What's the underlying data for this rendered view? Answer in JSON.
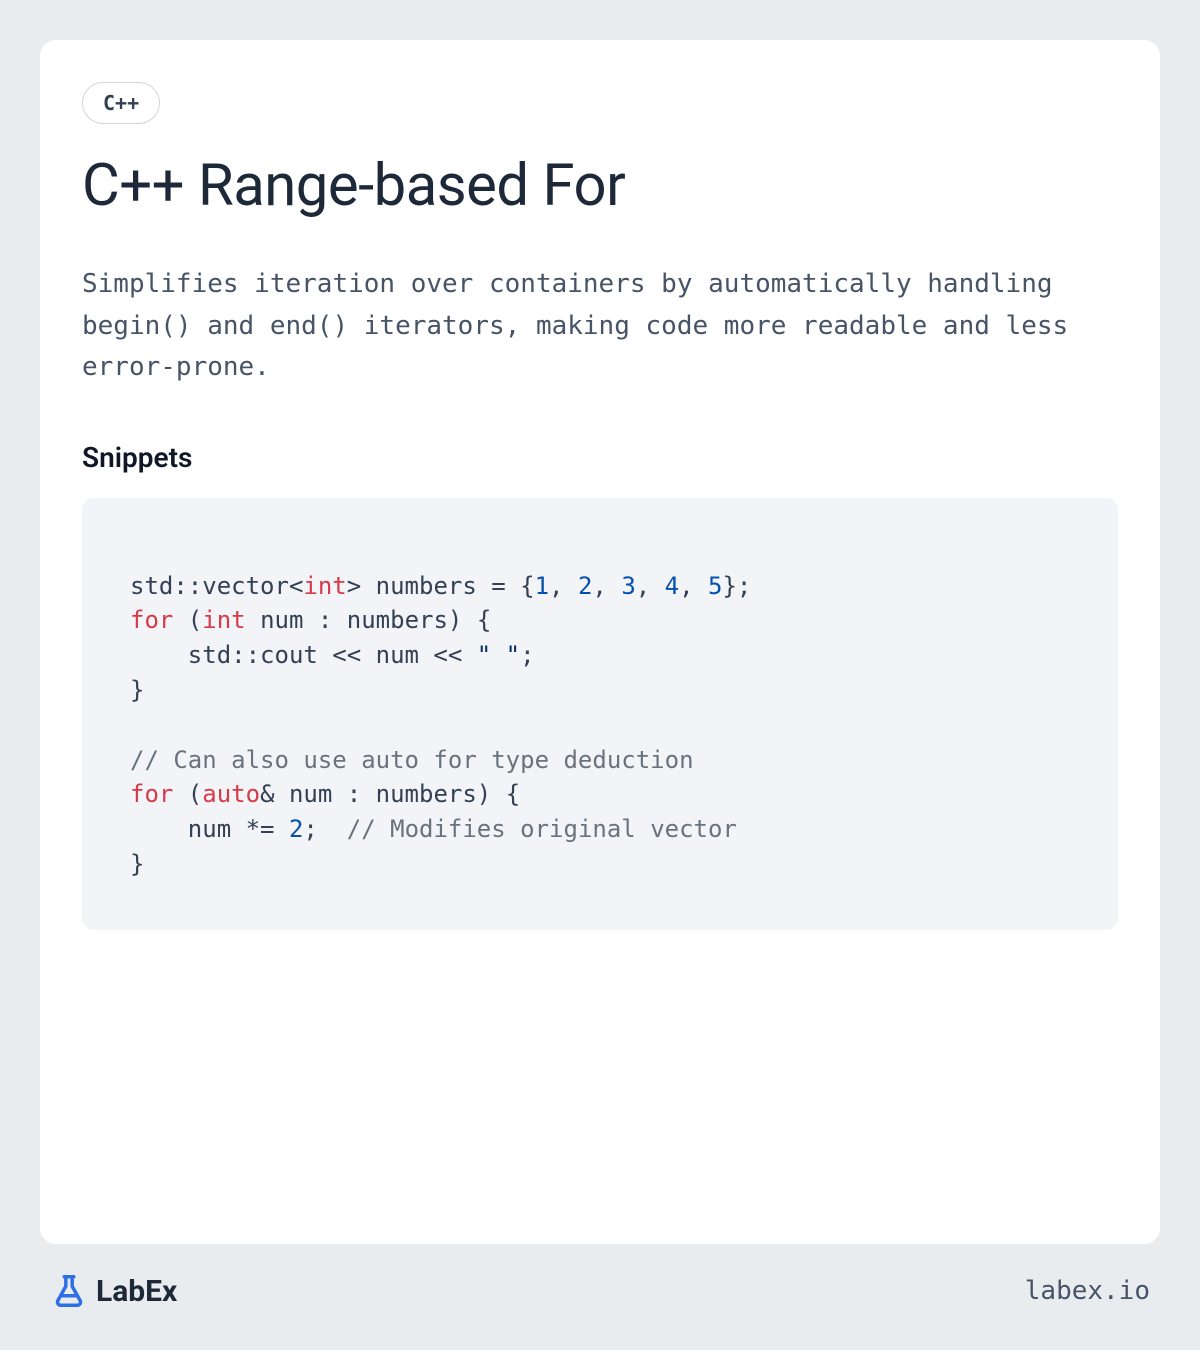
{
  "tag": "C++",
  "title": "C++ Range-based For",
  "description": "Simplifies iteration over containers by automatically handling begin() and end() iterators, making code more readable and less error-prone.",
  "section_title": "Snippets",
  "code": {
    "line1_a": "std::vector<",
    "line1_type": "int",
    "line1_b": "> numbers = {",
    "line1_n1": "1",
    "line1_n2": "2",
    "line1_n3": "3",
    "line1_n4": "4",
    "line1_n5": "5",
    "line1_c": "};",
    "line2_kw": "for",
    "line2_a": " (",
    "line2_type": "int",
    "line2_b": " num : numbers) {",
    "line3_a": "    std::cout << num << ",
    "line3_str": "\" \"",
    "line3_b": ";",
    "line4": "}",
    "line6_comment": "// Can also use auto for type deduction",
    "line7_kw": "for",
    "line7_a": " (",
    "line7_type": "auto",
    "line7_b": "& num : numbers) {",
    "line8_a": "    num *= ",
    "line8_n": "2",
    "line8_b": ";  ",
    "line8_comment": "// Modifies original vector",
    "line9": "}"
  },
  "logo_text": "LabEx",
  "site_url": "labex.io"
}
